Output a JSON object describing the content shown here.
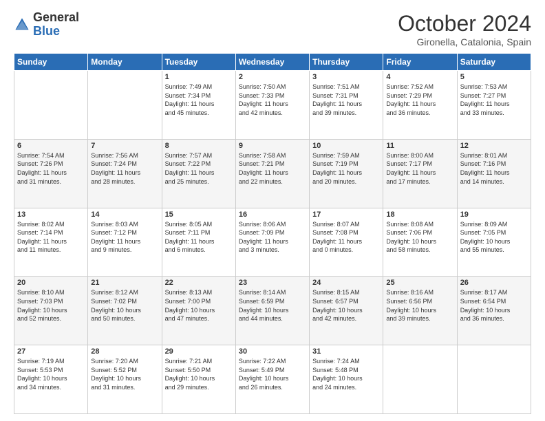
{
  "header": {
    "logo_general": "General",
    "logo_blue": "Blue",
    "month_title": "October 2024",
    "subtitle": "Gironella, Catalonia, Spain"
  },
  "days_of_week": [
    "Sunday",
    "Monday",
    "Tuesday",
    "Wednesday",
    "Thursday",
    "Friday",
    "Saturday"
  ],
  "weeks": [
    [
      {
        "num": "",
        "info": ""
      },
      {
        "num": "",
        "info": ""
      },
      {
        "num": "1",
        "info": "Sunrise: 7:49 AM\nSunset: 7:34 PM\nDaylight: 11 hours\nand 45 minutes."
      },
      {
        "num": "2",
        "info": "Sunrise: 7:50 AM\nSunset: 7:33 PM\nDaylight: 11 hours\nand 42 minutes."
      },
      {
        "num": "3",
        "info": "Sunrise: 7:51 AM\nSunset: 7:31 PM\nDaylight: 11 hours\nand 39 minutes."
      },
      {
        "num": "4",
        "info": "Sunrise: 7:52 AM\nSunset: 7:29 PM\nDaylight: 11 hours\nand 36 minutes."
      },
      {
        "num": "5",
        "info": "Sunrise: 7:53 AM\nSunset: 7:27 PM\nDaylight: 11 hours\nand 33 minutes."
      }
    ],
    [
      {
        "num": "6",
        "info": "Sunrise: 7:54 AM\nSunset: 7:26 PM\nDaylight: 11 hours\nand 31 minutes."
      },
      {
        "num": "7",
        "info": "Sunrise: 7:56 AM\nSunset: 7:24 PM\nDaylight: 11 hours\nand 28 minutes."
      },
      {
        "num": "8",
        "info": "Sunrise: 7:57 AM\nSunset: 7:22 PM\nDaylight: 11 hours\nand 25 minutes."
      },
      {
        "num": "9",
        "info": "Sunrise: 7:58 AM\nSunset: 7:21 PM\nDaylight: 11 hours\nand 22 minutes."
      },
      {
        "num": "10",
        "info": "Sunrise: 7:59 AM\nSunset: 7:19 PM\nDaylight: 11 hours\nand 20 minutes."
      },
      {
        "num": "11",
        "info": "Sunrise: 8:00 AM\nSunset: 7:17 PM\nDaylight: 11 hours\nand 17 minutes."
      },
      {
        "num": "12",
        "info": "Sunrise: 8:01 AM\nSunset: 7:16 PM\nDaylight: 11 hours\nand 14 minutes."
      }
    ],
    [
      {
        "num": "13",
        "info": "Sunrise: 8:02 AM\nSunset: 7:14 PM\nDaylight: 11 hours\nand 11 minutes."
      },
      {
        "num": "14",
        "info": "Sunrise: 8:03 AM\nSunset: 7:12 PM\nDaylight: 11 hours\nand 9 minutes."
      },
      {
        "num": "15",
        "info": "Sunrise: 8:05 AM\nSunset: 7:11 PM\nDaylight: 11 hours\nand 6 minutes."
      },
      {
        "num": "16",
        "info": "Sunrise: 8:06 AM\nSunset: 7:09 PM\nDaylight: 11 hours\nand 3 minutes."
      },
      {
        "num": "17",
        "info": "Sunrise: 8:07 AM\nSunset: 7:08 PM\nDaylight: 11 hours\nand 0 minutes."
      },
      {
        "num": "18",
        "info": "Sunrise: 8:08 AM\nSunset: 7:06 PM\nDaylight: 10 hours\nand 58 minutes."
      },
      {
        "num": "19",
        "info": "Sunrise: 8:09 AM\nSunset: 7:05 PM\nDaylight: 10 hours\nand 55 minutes."
      }
    ],
    [
      {
        "num": "20",
        "info": "Sunrise: 8:10 AM\nSunset: 7:03 PM\nDaylight: 10 hours\nand 52 minutes."
      },
      {
        "num": "21",
        "info": "Sunrise: 8:12 AM\nSunset: 7:02 PM\nDaylight: 10 hours\nand 50 minutes."
      },
      {
        "num": "22",
        "info": "Sunrise: 8:13 AM\nSunset: 7:00 PM\nDaylight: 10 hours\nand 47 minutes."
      },
      {
        "num": "23",
        "info": "Sunrise: 8:14 AM\nSunset: 6:59 PM\nDaylight: 10 hours\nand 44 minutes."
      },
      {
        "num": "24",
        "info": "Sunrise: 8:15 AM\nSunset: 6:57 PM\nDaylight: 10 hours\nand 42 minutes."
      },
      {
        "num": "25",
        "info": "Sunrise: 8:16 AM\nSunset: 6:56 PM\nDaylight: 10 hours\nand 39 minutes."
      },
      {
        "num": "26",
        "info": "Sunrise: 8:17 AM\nSunset: 6:54 PM\nDaylight: 10 hours\nand 36 minutes."
      }
    ],
    [
      {
        "num": "27",
        "info": "Sunrise: 7:19 AM\nSunset: 5:53 PM\nDaylight: 10 hours\nand 34 minutes."
      },
      {
        "num": "28",
        "info": "Sunrise: 7:20 AM\nSunset: 5:52 PM\nDaylight: 10 hours\nand 31 minutes."
      },
      {
        "num": "29",
        "info": "Sunrise: 7:21 AM\nSunset: 5:50 PM\nDaylight: 10 hours\nand 29 minutes."
      },
      {
        "num": "30",
        "info": "Sunrise: 7:22 AM\nSunset: 5:49 PM\nDaylight: 10 hours\nand 26 minutes."
      },
      {
        "num": "31",
        "info": "Sunrise: 7:24 AM\nSunset: 5:48 PM\nDaylight: 10 hours\nand 24 minutes."
      },
      {
        "num": "",
        "info": ""
      },
      {
        "num": "",
        "info": ""
      }
    ]
  ]
}
